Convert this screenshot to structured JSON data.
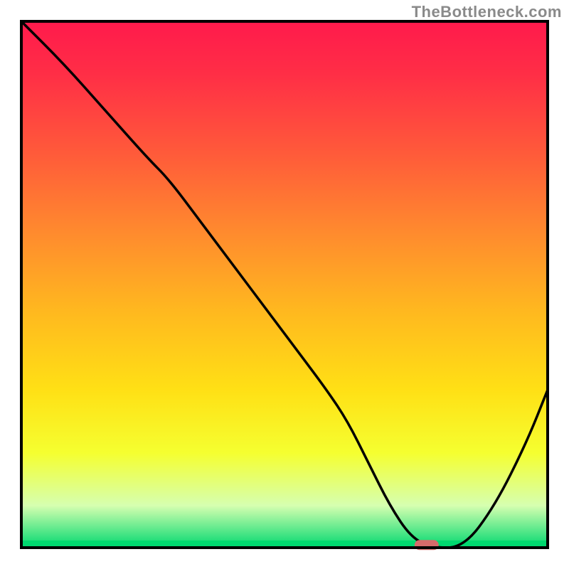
{
  "attribution": "TheBottleneck.com",
  "chart_data": {
    "type": "line",
    "title": "",
    "xlabel": "",
    "ylabel": "",
    "xlim": [
      0,
      100
    ],
    "ylim": [
      0,
      100
    ],
    "x": [
      0,
      8,
      16,
      24,
      28,
      34,
      40,
      46,
      52,
      58,
      62,
      66,
      70,
      74,
      78,
      84,
      90,
      96,
      100
    ],
    "values": [
      100,
      92,
      83,
      74,
      70,
      62,
      54,
      46,
      38,
      30,
      24,
      16,
      8,
      2,
      0,
      0,
      8,
      20,
      30
    ],
    "gradient_bands": [
      {
        "color": "#ff1a4c",
        "pos": 0.0
      },
      {
        "color": "#ff2e46",
        "pos": 0.1
      },
      {
        "color": "#ff5a3a",
        "pos": 0.25
      },
      {
        "color": "#ff8a2e",
        "pos": 0.4
      },
      {
        "color": "#ffb81f",
        "pos": 0.55
      },
      {
        "color": "#ffe015",
        "pos": 0.7
      },
      {
        "color": "#f5ff30",
        "pos": 0.82
      },
      {
        "color": "#d6ffb0",
        "pos": 0.92
      },
      {
        "color": "#00d870",
        "pos": 1.0
      }
    ],
    "marker": {
      "x": 77,
      "y": 0.5,
      "color": "#d66b6b"
    }
  }
}
